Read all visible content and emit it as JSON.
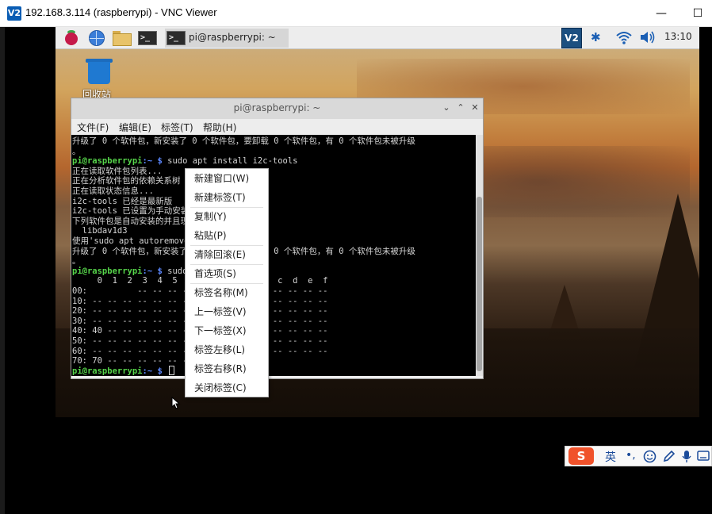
{
  "viewer": {
    "icon_text": "V2",
    "title": "192.168.3.114 (raspberrypi) - VNC Viewer",
    "minimize_symbol": "—",
    "maximize_symbol": "☐"
  },
  "panel": {
    "launchers": [
      "raspberry-menu-icon",
      "web-browser-icon",
      "file-manager-icon",
      "terminal-icon"
    ],
    "terminal_glyph": ">_",
    "task_title": "pi@raspberrypi: ~",
    "tray_vnc_text": "V2",
    "bluetooth_glyph": "✱",
    "clock": "13:10"
  },
  "desktop": {
    "trash_label": "回收站"
  },
  "terminal": {
    "title": "pi@raspberrypi: ~",
    "controls": [
      "⌄",
      "⌃",
      "✕"
    ],
    "menu": [
      "文件(F)",
      "编辑(E)",
      "标签(T)",
      "帮助(H)"
    ],
    "lines": [
      {
        "text": "升级了 0 个软件包，新安装了 0 个软件包，要卸载 0 个软件包，有 0 个软件包未被升级"
      },
      {
        "text": "。"
      },
      {
        "prompt": "pi@raspberrypi",
        "path": ":~ $",
        "text": " sudo apt install i2c-tools"
      },
      {
        "text": "正在读取软件包列表..."
      },
      {
        "text": "正在分析软件包的依赖关系树"
      },
      {
        "text": "正在读取状态信息..."
      },
      {
        "text": "i2c-tools 已经是最新版"
      },
      {
        "text": "i2c-tools 已设置为手动安装。"
      },
      {
        "text": "下列软件包是自动安装的并且现在不需要了："
      },
      {
        "text": "  libdav1d3"
      },
      {
        "text": "使用'sudo apt autoremove'来卸载它(它们)。"
      },
      {
        "text": "升级了 0 个软件包，新安装了 0 个软件包，要卸载 0 个软件包，有 0 个软件包未被升级"
      },
      {
        "text": "。"
      },
      {
        "prompt": "pi@raspberrypi",
        "path": ":~ $",
        "text": " sudo i2cdetect -y 1"
      },
      {
        "text": "     0  1  2  3  4  5  6  7  8  9  a  b  c  d  e  f"
      },
      {
        "text": "00:          -- -- -- -- -- -- -- -- -- -- -- -- --"
      },
      {
        "text": "10: -- -- -- -- -- -- -- -- -- -- -- -- -- -- -- --"
      },
      {
        "text": "20: -- -- -- -- -- -- -- -- -- -- -- -- -- -- -- --"
      },
      {
        "text": "30: -- -- -- -- -- -- -- -- -- -- -- -- -- -- -- --"
      },
      {
        "text": "40: 40 -- -- -- -- -- -- -- -- -- -- -- -- -- -- --"
      },
      {
        "text": "50: -- -- -- -- -- -- -- -- -- -- -- -- -- -- -- --"
      },
      {
        "text": "60: -- -- -- -- -- -- -- -- -- -- -- -- -- -- -- --"
      },
      {
        "text": "70: 70 -- -- -- -- -- -- --"
      },
      {
        "prompt": "pi@raspberrypi",
        "path": ":~ $",
        "text": " "
      }
    ]
  },
  "context_menu": {
    "items": [
      {
        "label": "新建窗口(W)",
        "separator_after": false
      },
      {
        "label": "新建标签(T)",
        "separator_after": true
      },
      {
        "label": "复制(Y)",
        "separator_after": false
      },
      {
        "label": "粘贴(P)",
        "separator_after": true
      },
      {
        "label": "清除回滚(E)",
        "separator_after": true
      },
      {
        "label": "首选项(S)",
        "separator_after": true
      },
      {
        "label": "标签名称(M)",
        "separator_after": false
      },
      {
        "label": "上一标签(V)",
        "separator_after": false
      },
      {
        "label": "下一标签(X)",
        "separator_after": false
      },
      {
        "label": "标签左移(L)",
        "separator_after": false
      },
      {
        "label": "标签右移(R)",
        "separator_after": false
      },
      {
        "label": "关闭标签(C)",
        "separator_after": false
      }
    ]
  },
  "ime": {
    "logo": "S",
    "lang": "英",
    "punct": "•,",
    "icons": [
      "emoji-icon",
      "pen-icon",
      "mic-icon",
      "keyboard-icon"
    ]
  },
  "colors": {
    "prompt_green": "#56d44a",
    "path_blue": "#5c87ff",
    "terminal_bg": "#000000",
    "ime_brand": "#f0522b"
  }
}
